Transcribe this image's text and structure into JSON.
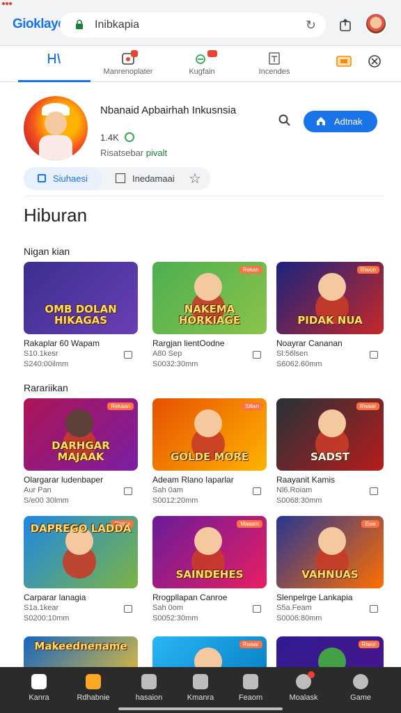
{
  "browser": {
    "brand": "Gioklaye",
    "url": "Inibkapia"
  },
  "tabs": [
    {
      "label": "",
      "icon": "layout-icon"
    },
    {
      "label": "Manrenoplater",
      "icon": "notification-icon"
    },
    {
      "label": "Kugfain",
      "icon": "tag-icon"
    },
    {
      "label": "Incendes",
      "icon": "document-icon"
    },
    {
      "label": "",
      "icon": "ticket-icon"
    },
    {
      "label": "",
      "icon": "settings-icon"
    }
  ],
  "app": {
    "title": "Nbanaid Apbairhah Inkusnsia",
    "rating": "1.4K",
    "sub_left": "Risatsebar",
    "sub_right": "pivalt",
    "install_label": "Adtnak"
  },
  "chips": [
    {
      "label": "Siuhaesi"
    },
    {
      "label": "Inedamaai"
    }
  ],
  "section_title": "Hiburan",
  "rows": [
    {
      "title": "Nigan kian",
      "cards": [
        {
          "thumb_title": "OMB DOLAN HIKAGAS",
          "tag": "",
          "name": "Rakaplar 60 Wapam",
          "meta1": "S10.1kesr",
          "meta2": "S240:00ilmm",
          "colors": [
            "#3b2f8f",
            "#6a3fb5"
          ]
        },
        {
          "thumb_title": "NAKEMA HORKIAGE",
          "tag": "Rekan",
          "name": "Rargjan lientOodne",
          "meta1": "A80 Sep",
          "meta2": "S0032:30mm",
          "colors": [
            "#4caf50",
            "#8bc34a"
          ]
        },
        {
          "thumb_title": "PIDAK NUA",
          "tag": "Riwon",
          "name": "Noayrar Cananan",
          "meta1": "Sl:56lsen",
          "meta2": "S6062.60mm",
          "colors": [
            "#1a237e",
            "#c62828"
          ]
        }
      ]
    },
    {
      "title": "Rarariikan",
      "cards": [
        {
          "thumb_title": "DARHGAR MAJAAK",
          "tag": "Rekaan",
          "name": "Olargarar ludenbaper",
          "meta1": "Aur Pan",
          "meta2": "S/e00 30lmm",
          "colors": [
            "#ad1457",
            "#7b1fa2"
          ]
        },
        {
          "thumb_title": "GOLDE MORE",
          "tag": "Siltan",
          "name": "Adeam Rlano Iaparlar",
          "meta1": "Sah 0am",
          "meta2": "S0012:20mm",
          "colors": [
            "#e65100",
            "#ffb300"
          ]
        },
        {
          "thumb_title": "SADST",
          "tag": "Rwaar",
          "name": "Raayanit Kamis",
          "meta1": "Nl6.Roiam",
          "meta2": "S0068:30mm",
          "colors": [
            "#263238",
            "#b71c1c"
          ]
        }
      ]
    },
    {
      "title": "",
      "cards": [
        {
          "thumb_title": "DAPREGO LADDA",
          "tag": "Rintos",
          "name": "Carparar lanagia",
          "meta1": "S1a.1kear",
          "meta2": "S0200:10mm",
          "colors": [
            "#1e88e5",
            "#7cb342"
          ]
        },
        {
          "thumb_title": "SAINDEHES",
          "tag": "Maaam",
          "name": "Rrogpllapan Canroe",
          "meta1": "Sah 0om",
          "meta2": "S0052:30mm",
          "colors": [
            "#6a1b9a",
            "#e91e63"
          ]
        },
        {
          "thumb_title": "VAHNUAS",
          "tag": "Ewe",
          "name": "Slenpelrge Lankapia",
          "meta1": "S5a.Feam",
          "meta2": "S0006:80mm",
          "colors": [
            "#283593",
            "#ff6f00"
          ]
        }
      ]
    },
    {
      "title": "",
      "cards": [
        {
          "thumb_title": "Makeednename",
          "tag": "",
          "name": "",
          "meta1": "",
          "meta2": "",
          "colors": [
            "#1565c0",
            "#ffca28"
          ]
        },
        {
          "thumb_title": "",
          "tag": "Rwaar",
          "name": "",
          "meta1": "",
          "meta2": "",
          "colors": [
            "#29b6f6",
            "#0277bd"
          ]
        },
        {
          "thumb_title": "",
          "tag": "Riwor",
          "name": "",
          "meta1": "",
          "meta2": "",
          "colors": [
            "#311b92",
            "#4a148c"
          ]
        }
      ]
    }
  ],
  "bottom_nav": [
    {
      "label": "Kanra",
      "icon": "home-icon",
      "active": true
    },
    {
      "label": "Rdhabnie",
      "icon": "gift-icon",
      "orange": true
    },
    {
      "label": "hasaion",
      "icon": "chat-icon"
    },
    {
      "label": "Kmanra",
      "icon": "crown-icon"
    },
    {
      "label": "Feaom",
      "icon": "camera-icon"
    },
    {
      "label": "Moalask",
      "icon": "target-icon",
      "badge": true
    },
    {
      "label": "Game",
      "icon": "profile-icon"
    }
  ],
  "colors": {
    "accent": "#1a73e8",
    "bottom_nav_bg": "#2b2b2b",
    "badge": "#ea4335"
  }
}
